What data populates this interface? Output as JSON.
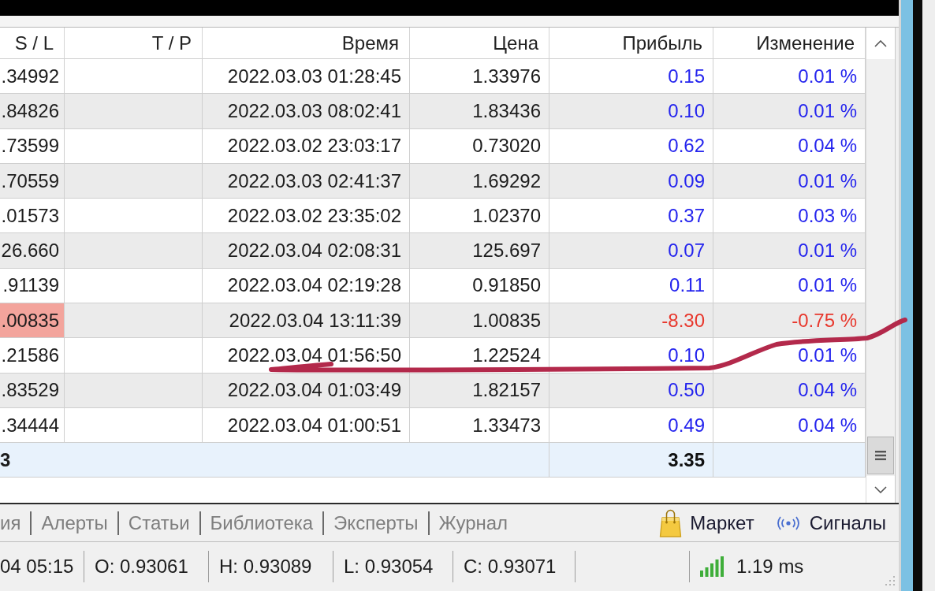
{
  "table": {
    "columns": [
      "S / L",
      "T / P",
      "Время",
      "Цена",
      "Прибыль",
      "Изменение"
    ],
    "rows": [
      {
        "sl": ".34992",
        "time": "2022.03.03 01:28:45",
        "price": "1.33976",
        "profit": "0.15",
        "change": "0.01 %",
        "loss": false,
        "sl_hit": false
      },
      {
        "sl": ".84826",
        "time": "2022.03.03 08:02:41",
        "price": "1.83436",
        "profit": "0.10",
        "change": "0.01 %",
        "loss": false,
        "sl_hit": false
      },
      {
        "sl": ".73599",
        "time": "2022.03.02 23:03:17",
        "price": "0.73020",
        "profit": "0.62",
        "change": "0.04 %",
        "loss": false,
        "sl_hit": false
      },
      {
        "sl": ".70559",
        "time": "2022.03.03 02:41:37",
        "price": "1.69292",
        "profit": "0.09",
        "change": "0.01 %",
        "loss": false,
        "sl_hit": false
      },
      {
        "sl": ".01573",
        "time": "2022.03.02 23:35:02",
        "price": "1.02370",
        "profit": "0.37",
        "change": "0.03 %",
        "loss": false,
        "sl_hit": false
      },
      {
        "sl": "26.660",
        "time": "2022.03.04 02:08:31",
        "price": "125.697",
        "profit": "0.07",
        "change": "0.01 %",
        "loss": false,
        "sl_hit": false
      },
      {
        "sl": ".91139",
        "time": "2022.03.04 02:19:28",
        "price": "0.91850",
        "profit": "0.11",
        "change": "0.01 %",
        "loss": false,
        "sl_hit": false
      },
      {
        "sl": ".00835",
        "time": "2022.03.04 13:11:39",
        "price": "1.00835",
        "profit": "-8.30",
        "change": "-0.75 %",
        "loss": true,
        "sl_hit": true
      },
      {
        "sl": ".21586",
        "time": "2022.03.04 01:56:50",
        "price": "1.22524",
        "profit": "0.10",
        "change": "0.01 %",
        "loss": false,
        "sl_hit": false
      },
      {
        "sl": ".83529",
        "time": "2022.03.04 01:03:49",
        "price": "1.82157",
        "profit": "0.50",
        "change": "0.04 %",
        "loss": false,
        "sl_hit": false
      },
      {
        "sl": ".34444",
        "time": "2022.03.04 01:00:51",
        "price": "1.33473",
        "profit": "0.49",
        "change": "0.04 %",
        "loss": false,
        "sl_hit": false
      }
    ],
    "total": {
      "label": "3",
      "profit": "3.35"
    }
  },
  "tabs": [
    "ия",
    "Алерты",
    "Статьи",
    "Библиотека",
    "Эксперты",
    "Журнал"
  ],
  "links": [
    {
      "kind": "market",
      "label": "Маркет"
    },
    {
      "kind": "signals",
      "label": "Сигналы"
    }
  ],
  "status_bar": {
    "cells": [
      "04 05:15",
      "O: 0.93061",
      "H: 0.93089",
      "L: 0.93054",
      "C: 0.93071"
    ],
    "ping": "1.19 ms"
  },
  "overlay": {
    "kind": "pen-stroke"
  }
}
